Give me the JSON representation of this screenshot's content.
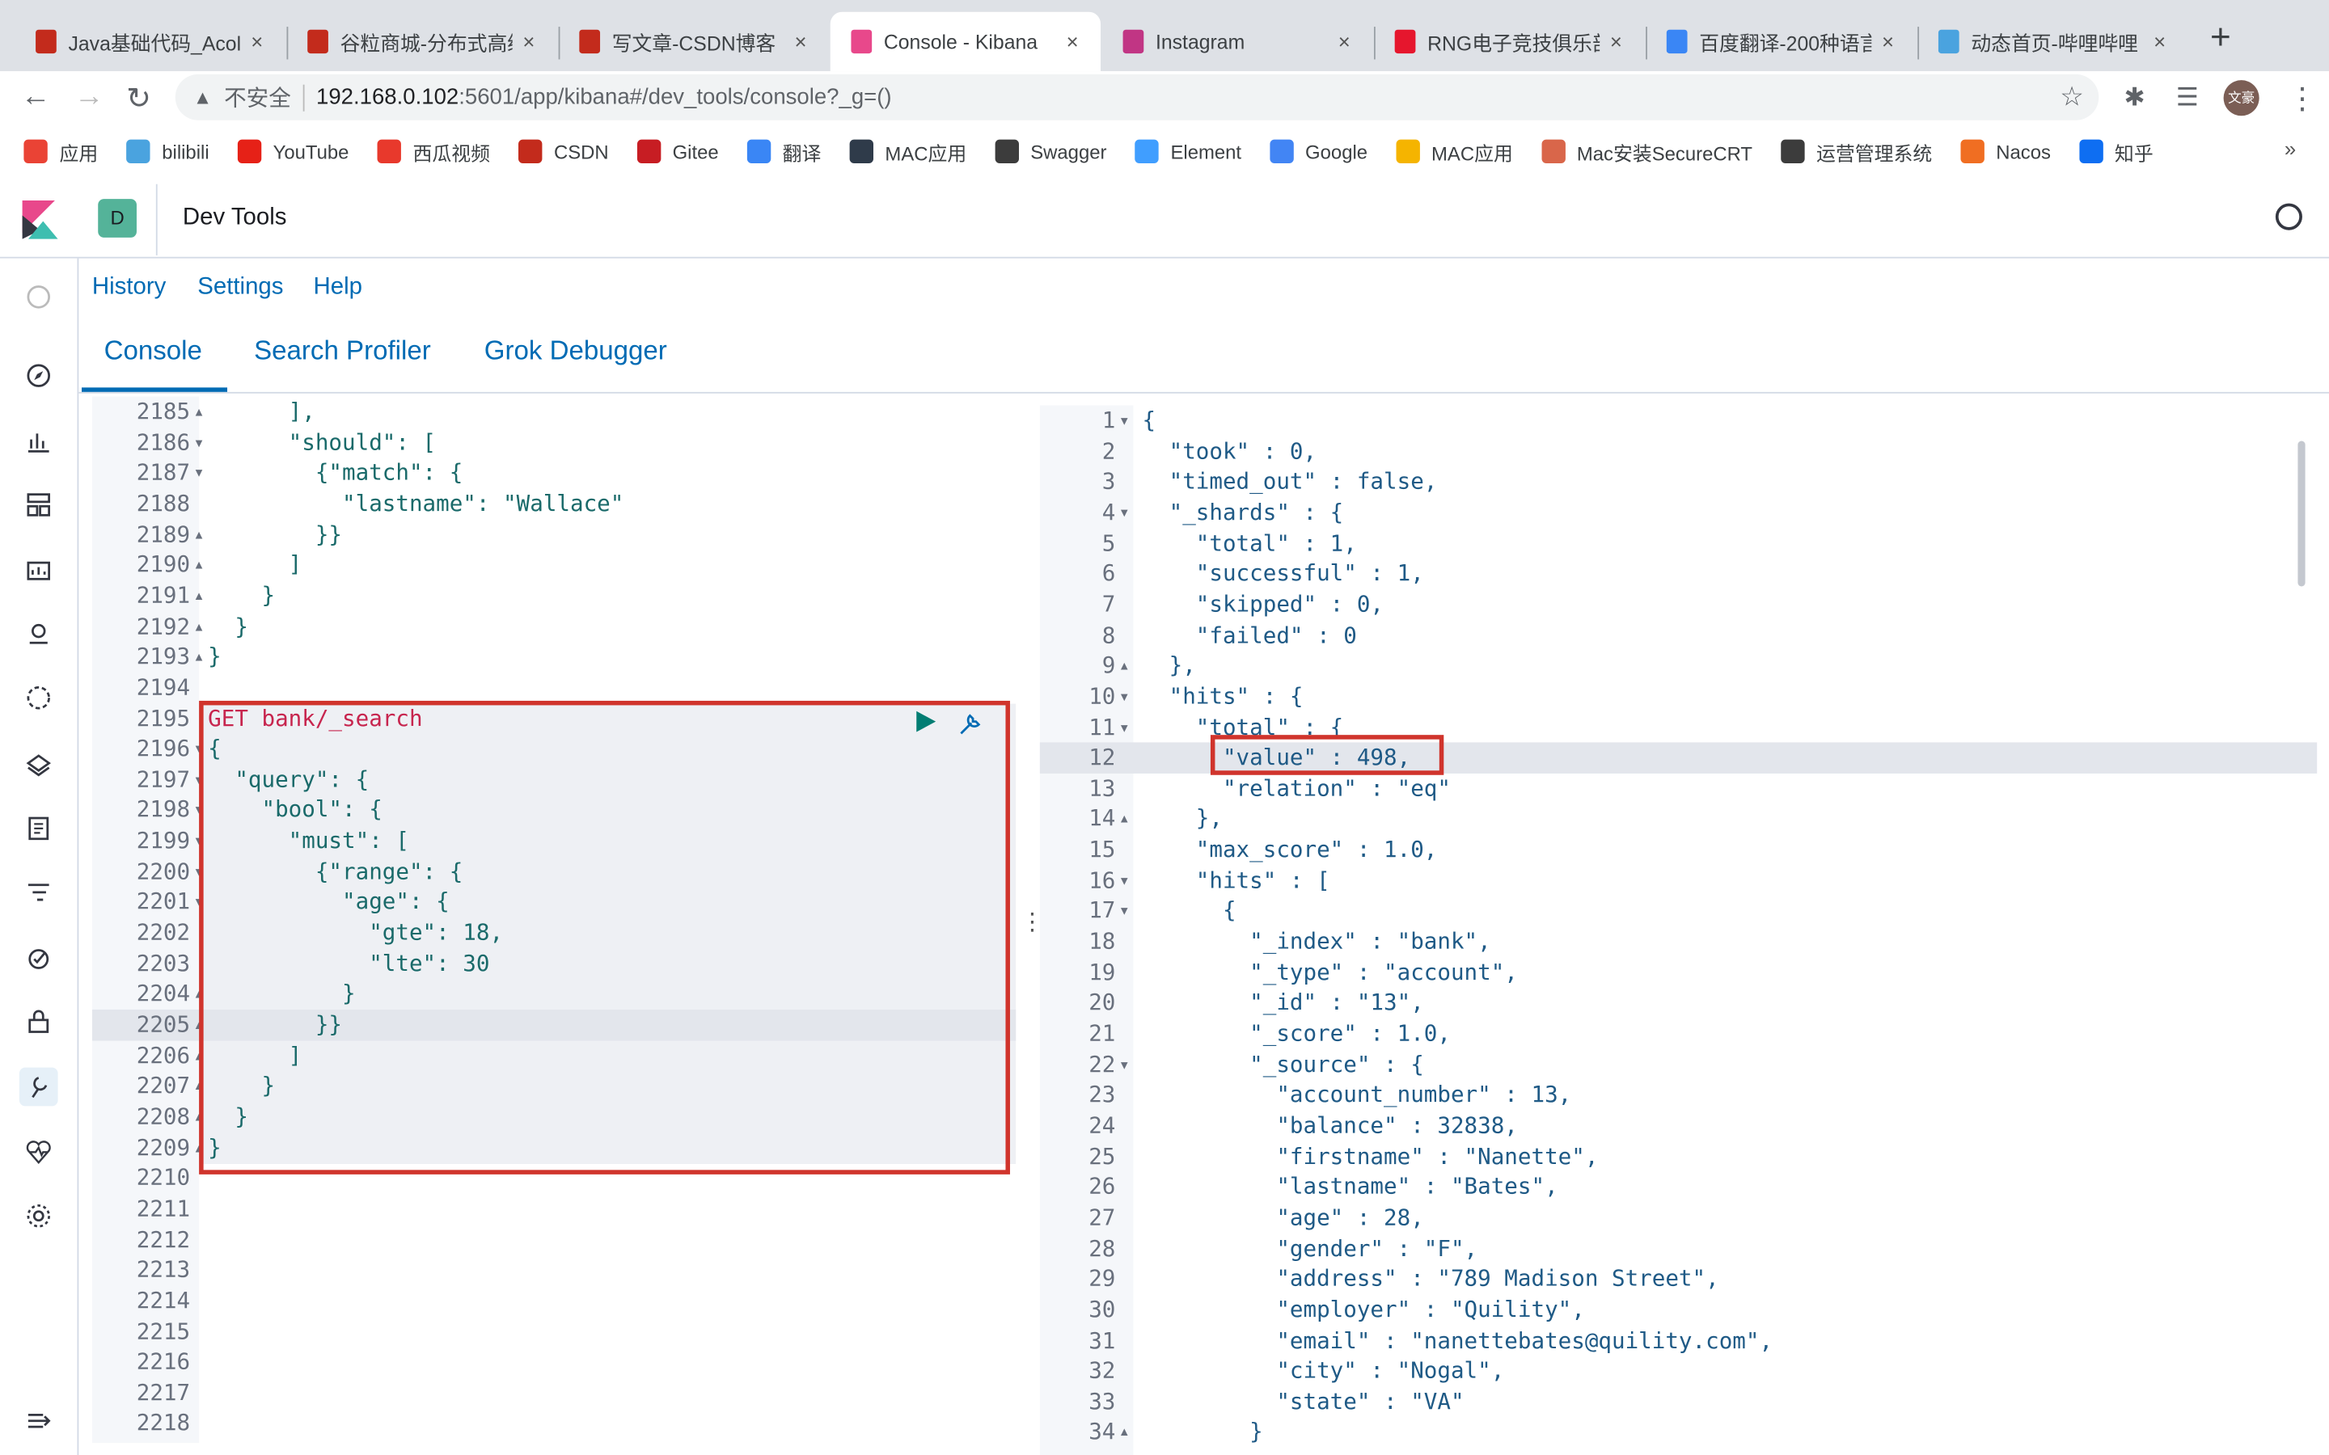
{
  "browser": {
    "tabs": [
      {
        "title": "Java基础代码_Acol",
        "icon": "csdn-icon",
        "color": "#c32b1c",
        "active": false
      },
      {
        "title": "谷粒商城-分布式高级",
        "icon": "csdn-icon",
        "color": "#c32b1c",
        "active": false
      },
      {
        "title": "写文章-CSDN博客",
        "icon": "csdn-icon",
        "color": "#c32b1c",
        "active": false
      },
      {
        "title": "Console - Kibana",
        "icon": "kibana-icon",
        "color": "#e8488b",
        "active": true
      },
      {
        "title": "Instagram",
        "icon": "instagram-icon",
        "color": "#c13584",
        "active": false
      },
      {
        "title": "RNG电子竞技俱乐部",
        "icon": "weibo-icon",
        "color": "#e6162d",
        "active": false
      },
      {
        "title": "百度翻译-200种语言",
        "icon": "translate-icon",
        "color": "#3a86f5",
        "active": false
      },
      {
        "title": "动态首页-哔哩哔哩",
        "icon": "bilibili-icon",
        "color": "#4aa3df",
        "active": false
      }
    ],
    "new_tab": "+",
    "close": "×",
    "insecure_label": "不安全",
    "url_host": "192.168.0.102",
    "url_path": ":5601/app/kibana#/dev_tools/console?_g=()",
    "profile_initials": "文豪",
    "bookmarks": [
      {
        "label": "应用",
        "icon": "apps-grid-icon",
        "color": "#ea4335"
      },
      {
        "label": "bilibili",
        "icon": "bilibili-icon",
        "color": "#4aa3df"
      },
      {
        "label": "YouTube",
        "icon": "youtube-icon",
        "color": "#e62117"
      },
      {
        "label": "西瓜视频",
        "icon": "xigua-icon",
        "color": "#e8392c"
      },
      {
        "label": "CSDN",
        "icon": "csdn-icon",
        "color": "#c32b1c"
      },
      {
        "label": "Gitee",
        "icon": "gitee-icon",
        "color": "#c71d23"
      },
      {
        "label": "翻译",
        "icon": "translate-icon",
        "color": "#3a86f5"
      },
      {
        "label": "MAC应用",
        "icon": "mac-app-icon",
        "color": "#2f3b4a"
      },
      {
        "label": "Swagger",
        "icon": "swagger-icon",
        "color": "#3c3c3c"
      },
      {
        "label": "Element",
        "icon": "element-icon",
        "color": "#409eff"
      },
      {
        "label": "Google",
        "icon": "google-icon",
        "color": "#4285f4"
      },
      {
        "label": "MAC应用",
        "icon": "pineapple-icon",
        "color": "#f5b400"
      },
      {
        "label": "Mac安装SecureCRT",
        "icon": "jian-icon",
        "color": "#d9664a"
      },
      {
        "label": "运营管理系统",
        "icon": "globe-icon",
        "color": "#3c3c3c"
      },
      {
        "label": "Nacos",
        "icon": "nacos-icon",
        "color": "#f06e22"
      },
      {
        "label": "知乎",
        "icon": "zhihu-icon",
        "color": "#0e6ef2"
      }
    ],
    "more_bookmarks": "»"
  },
  "kibana": {
    "space_initial": "D",
    "space_color": "#54b399",
    "title": "Dev Tools",
    "links": [
      "History",
      "Settings",
      "Help"
    ],
    "tabs": [
      {
        "label": "Console",
        "active": true
      },
      {
        "label": "Search Profiler",
        "active": false
      },
      {
        "label": "Grok Debugger",
        "active": false
      }
    ],
    "accent_color": "#006bb4",
    "nav_icons": [
      "recent-icon",
      "discover-icon",
      "visualize-icon",
      "dashboard-icon",
      "canvas-icon",
      "maps-icon",
      "ml-icon",
      "infrastructure-icon",
      "logs-icon",
      "apm-icon",
      "uptime-icon",
      "siem-icon",
      "dev-tools-icon",
      "monitoring-icon",
      "management-icon"
    ],
    "collapse_icon": "collapse-nav-icon"
  },
  "request_editor": {
    "lines": [
      {
        "n": 2185,
        "fold": "up",
        "text": "      ],"
      },
      {
        "n": 2186,
        "fold": "down",
        "text": "      \"should\": ["
      },
      {
        "n": 2187,
        "fold": "down",
        "text": "        {\"match\": {"
      },
      {
        "n": 2188,
        "fold": "",
        "text": "          \"lastname\": \"Wallace\""
      },
      {
        "n": 2189,
        "fold": "up",
        "text": "        }}"
      },
      {
        "n": 2190,
        "fold": "up",
        "text": "      ]"
      },
      {
        "n": 2191,
        "fold": "up",
        "text": "    }"
      },
      {
        "n": 2192,
        "fold": "up",
        "text": "  }"
      },
      {
        "n": 2193,
        "fold": "up",
        "text": "}"
      },
      {
        "n": 2194,
        "fold": "",
        "text": ""
      },
      {
        "n": 2195,
        "fold": "",
        "text": "GET bank/_search"
      },
      {
        "n": 2196,
        "fold": "down",
        "text": "{"
      },
      {
        "n": 2197,
        "fold": "down",
        "text": "  \"query\": {"
      },
      {
        "n": 2198,
        "fold": "down",
        "text": "    \"bool\": {"
      },
      {
        "n": 2199,
        "fold": "down",
        "text": "      \"must\": ["
      },
      {
        "n": 2200,
        "fold": "down",
        "text": "        {\"range\": {"
      },
      {
        "n": 2201,
        "fold": "down",
        "text": "          \"age\": {"
      },
      {
        "n": 2202,
        "fold": "",
        "text": "            \"gte\": 18,"
      },
      {
        "n": 2203,
        "fold": "",
        "text": "            \"lte\": 30"
      },
      {
        "n": 2204,
        "fold": "up",
        "text": "          }"
      },
      {
        "n": 2205,
        "fold": "up",
        "text": "        }}"
      },
      {
        "n": 2206,
        "fold": "up",
        "text": "      ]"
      },
      {
        "n": 2207,
        "fold": "up",
        "text": "    }"
      },
      {
        "n": 2208,
        "fold": "up",
        "text": "  }"
      },
      {
        "n": 2209,
        "fold": "up",
        "text": "}"
      },
      {
        "n": 2210,
        "fold": "",
        "text": ""
      },
      {
        "n": 2211,
        "fold": "",
        "text": ""
      },
      {
        "n": 2212,
        "fold": "",
        "text": ""
      },
      {
        "n": 2213,
        "fold": "",
        "text": ""
      },
      {
        "n": 2214,
        "fold": "",
        "text": ""
      },
      {
        "n": 2215,
        "fold": "",
        "text": ""
      },
      {
        "n": 2216,
        "fold": "",
        "text": ""
      },
      {
        "n": 2217,
        "fold": "",
        "text": ""
      },
      {
        "n": 2218,
        "fold": "",
        "text": ""
      }
    ],
    "active_line": 2205,
    "run_icon": "play-icon",
    "settings_icon": "wrench-icon",
    "run_color": "#017d73"
  },
  "response_editor": {
    "lines": [
      {
        "n": 1,
        "fold": "down",
        "text": "{"
      },
      {
        "n": 2,
        "fold": "",
        "text": "  \"took\" : 0,"
      },
      {
        "n": 3,
        "fold": "",
        "text": "  \"timed_out\" : false,"
      },
      {
        "n": 4,
        "fold": "down",
        "text": "  \"_shards\" : {"
      },
      {
        "n": 5,
        "fold": "",
        "text": "    \"total\" : 1,"
      },
      {
        "n": 6,
        "fold": "",
        "text": "    \"successful\" : 1,"
      },
      {
        "n": 7,
        "fold": "",
        "text": "    \"skipped\" : 0,"
      },
      {
        "n": 8,
        "fold": "",
        "text": "    \"failed\" : 0"
      },
      {
        "n": 9,
        "fold": "up",
        "text": "  },"
      },
      {
        "n": 10,
        "fold": "down",
        "text": "  \"hits\" : {"
      },
      {
        "n": 11,
        "fold": "down",
        "text": "    \"total\" : {"
      },
      {
        "n": 12,
        "fold": "",
        "text": "      \"value\" : 498,"
      },
      {
        "n": 13,
        "fold": "",
        "text": "      \"relation\" : \"eq\""
      },
      {
        "n": 14,
        "fold": "up",
        "text": "    },"
      },
      {
        "n": 15,
        "fold": "",
        "text": "    \"max_score\" : 1.0,"
      },
      {
        "n": 16,
        "fold": "down",
        "text": "    \"hits\" : ["
      },
      {
        "n": 17,
        "fold": "down",
        "text": "      {"
      },
      {
        "n": 18,
        "fold": "",
        "text": "        \"_index\" : \"bank\","
      },
      {
        "n": 19,
        "fold": "",
        "text": "        \"_type\" : \"account\","
      },
      {
        "n": 20,
        "fold": "",
        "text": "        \"_id\" : \"13\","
      },
      {
        "n": 21,
        "fold": "",
        "text": "        \"_score\" : 1.0,"
      },
      {
        "n": 22,
        "fold": "down",
        "text": "        \"_source\" : {"
      },
      {
        "n": 23,
        "fold": "",
        "text": "          \"account_number\" : 13,"
      },
      {
        "n": 24,
        "fold": "",
        "text": "          \"balance\" : 32838,"
      },
      {
        "n": 25,
        "fold": "",
        "text": "          \"firstname\" : \"Nanette\","
      },
      {
        "n": 26,
        "fold": "",
        "text": "          \"lastname\" : \"Bates\","
      },
      {
        "n": 27,
        "fold": "",
        "text": "          \"age\" : 28,"
      },
      {
        "n": 28,
        "fold": "",
        "text": "          \"gender\" : \"F\","
      },
      {
        "n": 29,
        "fold": "",
        "text": "          \"address\" : \"789 Madison Street\","
      },
      {
        "n": 30,
        "fold": "",
        "text": "          \"employer\" : \"Quility\","
      },
      {
        "n": 31,
        "fold": "",
        "text": "          \"email\" : \"nanettebates@quility.com\","
      },
      {
        "n": 32,
        "fold": "",
        "text": "          \"city\" : \"Nogal\","
      },
      {
        "n": 33,
        "fold": "",
        "text": "          \"state\" : \"VA\""
      },
      {
        "n": 34,
        "fold": "up",
        "text": "        }"
      }
    ],
    "active_line": 12
  },
  "annotation_color": "#d0342c"
}
